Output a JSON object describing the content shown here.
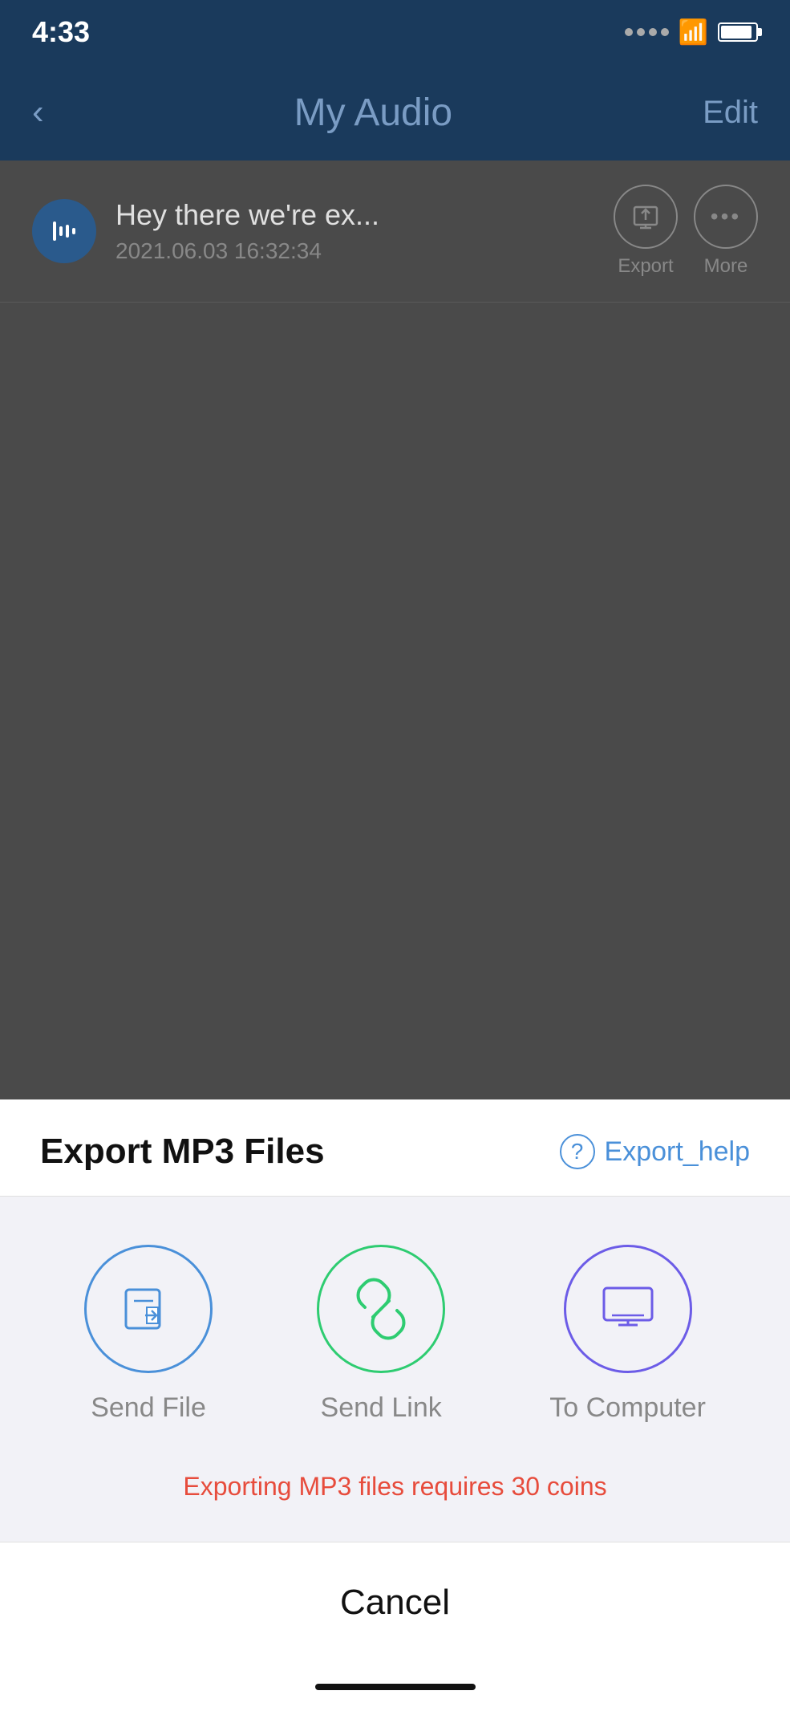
{
  "statusBar": {
    "time": "4:33",
    "orangeDot": true
  },
  "navHeader": {
    "backLabel": "‹",
    "title": "My Audio",
    "editLabel": "Edit"
  },
  "audioItem": {
    "title": "Hey there we're ex...",
    "date": "2021.06.03 16:32:34",
    "exportLabel": "Export",
    "moreLabel": "More"
  },
  "exportSheet": {
    "title": "Export MP3 Files",
    "helpLabel": "Export_help",
    "options": [
      {
        "id": "send-file",
        "label": "Send File",
        "color": "blue"
      },
      {
        "id": "send-link",
        "label": "Send Link",
        "color": "green"
      },
      {
        "id": "to-computer",
        "label": "To Computer",
        "color": "purple"
      }
    ],
    "coinsNotice": "Exporting MP3 files requires 30 coins",
    "cancelLabel": "Cancel"
  }
}
